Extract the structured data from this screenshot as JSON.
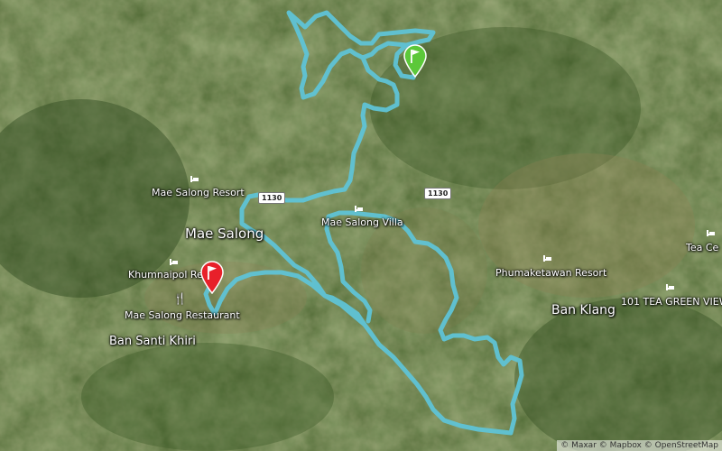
{
  "map": {
    "towns": [
      {
        "id": "mae-salong",
        "label": "Mae Salong"
      },
      {
        "id": "ban-klang",
        "label": "Ban Klang"
      },
      {
        "id": "ban-santi-khiri",
        "label": "Ban Santi Khiri"
      }
    ],
    "pois": [
      {
        "id": "mae-salong-resort",
        "label": "Mae Salong Resort",
        "icon": "hotel-icon"
      },
      {
        "id": "mae-salong-villa",
        "label": "Mae Salong Villa",
        "icon": "hotel-icon"
      },
      {
        "id": "khumnaipol-resort",
        "label": "Khumnaipol Re",
        "icon": "hotel-icon"
      },
      {
        "id": "mae-salong-restaurant",
        "label": "Mae Salong Restaurant",
        "icon": "restaurant-icon"
      },
      {
        "id": "phumaketawan-resort",
        "label": "Phumaketawan Resort",
        "icon": "hotel-icon"
      },
      {
        "id": "tea-green-view",
        "label": "101 TEA GREEN VIEW",
        "icon": "hotel-icon"
      },
      {
        "id": "tea-ce",
        "label": "Tea Ce",
        "icon": "hotel-icon"
      }
    ],
    "road_shields": [
      {
        "id": "road-1130-west",
        "label": "1130"
      },
      {
        "id": "road-1130-east",
        "label": "1130"
      }
    ],
    "markers": [
      {
        "id": "start",
        "icon": "start-flag-icon",
        "color": "#5cc83a"
      },
      {
        "id": "finish",
        "icon": "finish-flag-icon",
        "color": "#e8202a"
      }
    ],
    "route_color": "#5fc3d6",
    "attribution": "© Maxar © Mapbox © OpenStreetMap"
  }
}
